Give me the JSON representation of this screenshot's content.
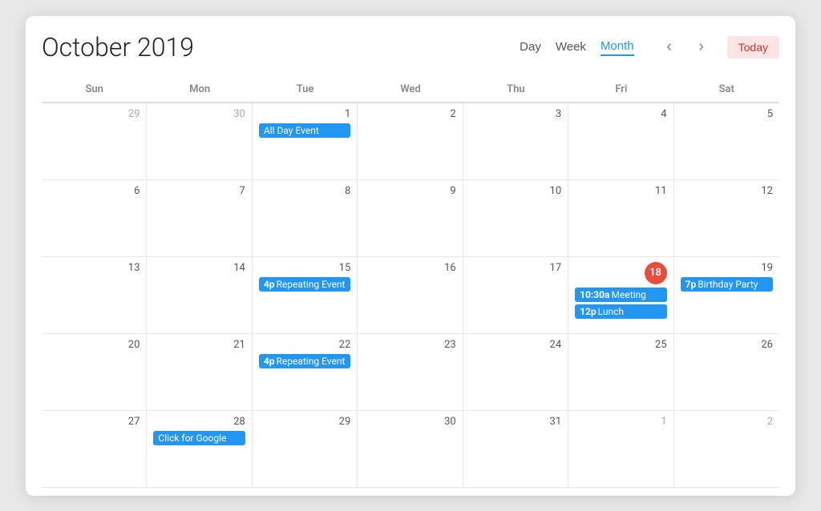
{
  "header": {
    "title": "October 2019",
    "view_day": "Day",
    "view_week": "Week",
    "view_month": "Month",
    "today_label": "Today"
  },
  "days_of_week": [
    "Sun",
    "Mon",
    "Tue",
    "Wed",
    "Thu",
    "Fri",
    "Sat"
  ],
  "weeks": [
    {
      "days": [
        {
          "num": "29",
          "current": false,
          "today": false,
          "events": []
        },
        {
          "num": "30",
          "current": false,
          "today": false,
          "events": []
        },
        {
          "num": "1",
          "current": true,
          "today": false,
          "events": [
            {
              "label": "All Day Event",
              "prefix": ""
            }
          ]
        },
        {
          "num": "2",
          "current": true,
          "today": false,
          "events": []
        },
        {
          "num": "3",
          "current": true,
          "today": false,
          "events": []
        },
        {
          "num": "4",
          "current": true,
          "today": false,
          "events": []
        },
        {
          "num": "5",
          "current": true,
          "today": false,
          "events": []
        }
      ]
    },
    {
      "days": [
        {
          "num": "6",
          "current": true,
          "today": false,
          "events": []
        },
        {
          "num": "7",
          "current": true,
          "today": false,
          "events": []
        },
        {
          "num": "8",
          "current": true,
          "today": false,
          "events": []
        },
        {
          "num": "9",
          "current": true,
          "today": false,
          "events": []
        },
        {
          "num": "10",
          "current": true,
          "today": false,
          "events": []
        },
        {
          "num": "11",
          "current": true,
          "today": false,
          "events": []
        },
        {
          "num": "12",
          "current": true,
          "today": false,
          "events": []
        }
      ]
    },
    {
      "days": [
        {
          "num": "13",
          "current": true,
          "today": false,
          "events": []
        },
        {
          "num": "14",
          "current": true,
          "today": false,
          "events": []
        },
        {
          "num": "15",
          "current": true,
          "today": false,
          "events": [
            {
              "label": "Repeating Event",
              "prefix": "4p"
            }
          ]
        },
        {
          "num": "16",
          "current": true,
          "today": false,
          "events": []
        },
        {
          "num": "17",
          "current": true,
          "today": false,
          "events": []
        },
        {
          "num": "18",
          "current": true,
          "today": true,
          "events": [
            {
              "label": "Meeting",
              "prefix": "10:30a"
            },
            {
              "label": "Lunch",
              "prefix": "12p"
            }
          ]
        },
        {
          "num": "19",
          "current": true,
          "today": false,
          "events": [
            {
              "label": "Birthday Party",
              "prefix": "7p"
            }
          ]
        }
      ]
    },
    {
      "days": [
        {
          "num": "20",
          "current": true,
          "today": false,
          "events": []
        },
        {
          "num": "21",
          "current": true,
          "today": false,
          "events": []
        },
        {
          "num": "22",
          "current": true,
          "today": false,
          "events": [
            {
              "label": "Repeating Event",
              "prefix": "4p"
            }
          ]
        },
        {
          "num": "23",
          "current": true,
          "today": false,
          "events": []
        },
        {
          "num": "24",
          "current": true,
          "today": false,
          "events": []
        },
        {
          "num": "25",
          "current": true,
          "today": false,
          "events": []
        },
        {
          "num": "26",
          "current": true,
          "today": false,
          "events": []
        }
      ]
    },
    {
      "days": [
        {
          "num": "27",
          "current": true,
          "today": false,
          "events": []
        },
        {
          "num": "28",
          "current": true,
          "today": false,
          "events": [
            {
              "label": "Click for Google",
              "prefix": ""
            }
          ]
        },
        {
          "num": "29",
          "current": true,
          "today": false,
          "events": []
        },
        {
          "num": "30",
          "current": true,
          "today": false,
          "events": []
        },
        {
          "num": "31",
          "current": true,
          "today": false,
          "events": []
        },
        {
          "num": "1",
          "current": false,
          "today": false,
          "events": []
        },
        {
          "num": "2",
          "current": false,
          "today": false,
          "events": []
        }
      ]
    }
  ]
}
